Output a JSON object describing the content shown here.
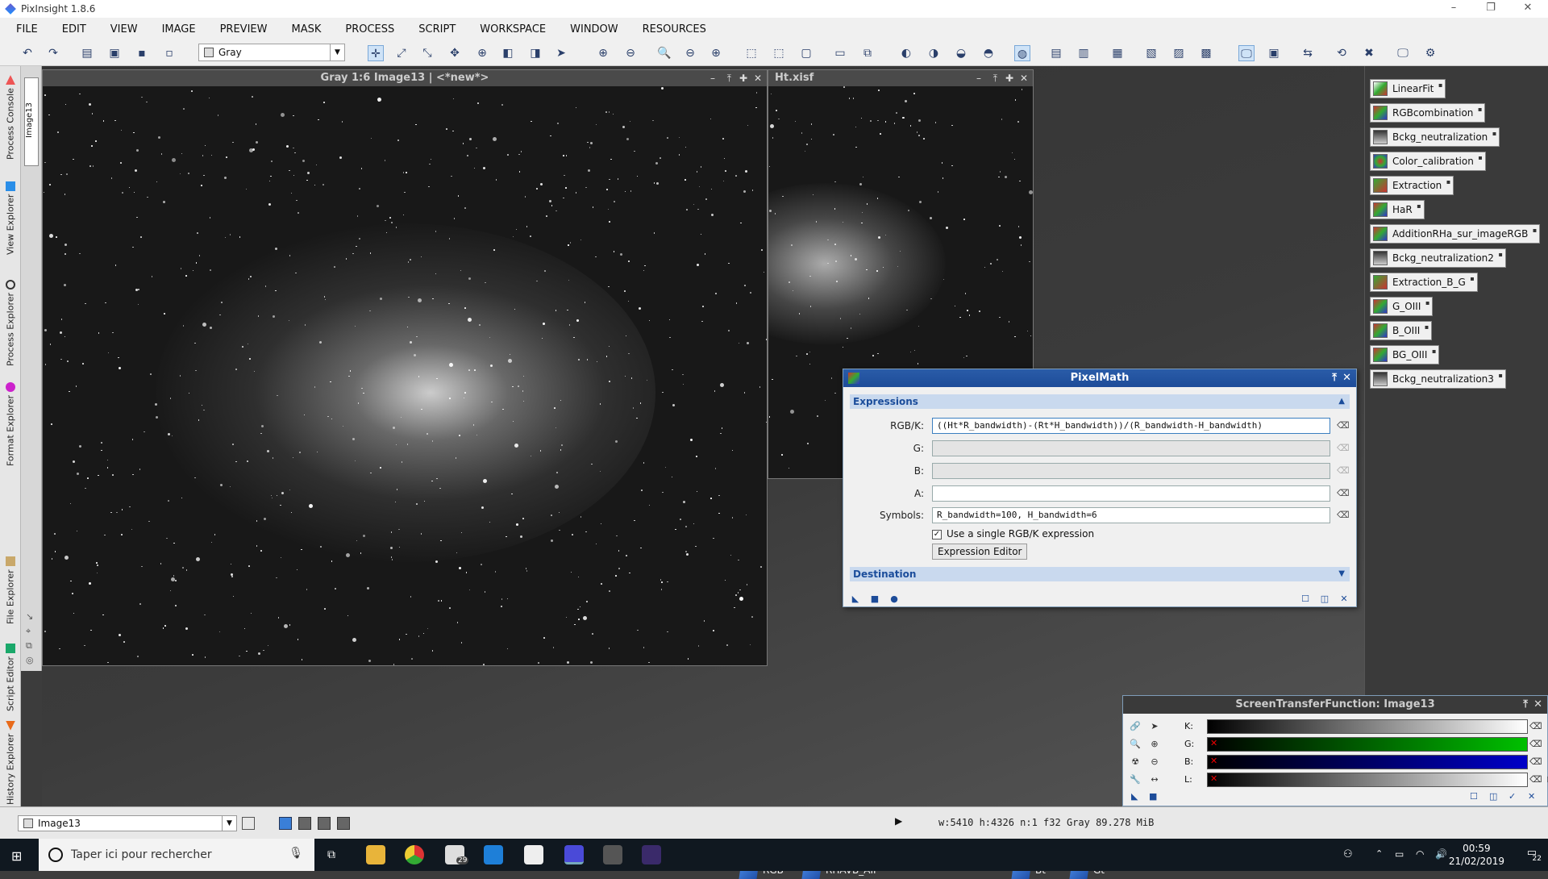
{
  "app": {
    "title": "PixInsight 1.8.6"
  },
  "window_controls": {
    "minimize": "–",
    "restore": "❐",
    "close": "✕"
  },
  "menu": [
    "FILE",
    "EDIT",
    "VIEW",
    "IMAGE",
    "PREVIEW",
    "MASK",
    "PROCESS",
    "SCRIPT",
    "WORKSPACE",
    "WINDOW",
    "RESOURCES"
  ],
  "toolbar": {
    "view_selector": "Gray"
  },
  "left_tabs": [
    "Process Console",
    "View Explorer",
    "Process Explorer",
    "Format Explorer",
    "File Explorer",
    "Script Editor",
    "History Explorer"
  ],
  "icon_tab": "Image13",
  "image_windows": [
    {
      "title": "Gray 1:6 Image13 | <*new*>"
    },
    {
      "title": "Ht.xisf"
    }
  ],
  "pixelmath": {
    "title": "PixelMath",
    "section_expressions": "Expressions",
    "labels": {
      "rgbk": "RGB/K:",
      "g": "G:",
      "b": "B:",
      "a": "A:",
      "symbols": "Symbols:"
    },
    "rgbk_expr": "((Ht*R_bandwidth)-(Rt*H_bandwidth))/(R_bandwidth-H_bandwidth)",
    "g_expr": "",
    "b_expr": "",
    "a_expr": "",
    "symbols": "R_bandwidth=100, H_bandwidth=6",
    "use_single_label": "Use a single RGB/K expression",
    "use_single": true,
    "expression_editor": "Expression Editor",
    "section_destination": "Destination"
  },
  "process_icons": [
    "LinearFit",
    "RGBcombination",
    "Bckg_neutralization",
    "Color_calibration",
    "Extraction",
    "HaR",
    "AdditionRHa_sur_imageRGB",
    "Bckg_neutralization2",
    "Extraction_B_G",
    "G_OIII",
    "B_OIII",
    "BG_OIII",
    "Bckg_neutralization3"
  ],
  "stf": {
    "title": "ScreenTransferFunction: Image13",
    "channels": [
      "K:",
      "G:",
      "B:",
      "L:"
    ]
  },
  "iconized_images": [
    "RGB",
    "RHAVB_AIP",
    "Bt",
    "Gt"
  ],
  "statusbar": {
    "current_view": "Image13",
    "info": "w:5410   h:4326   n:1   f32   Gray   89.278 MiB"
  },
  "taskbar": {
    "search_placeholder": "Taper ici pour rechercher",
    "mail_badge": "29",
    "time": "00:59",
    "date": "21/02/2019",
    "notif_count": "22"
  },
  "colors": {
    "accent": "#1d4c99",
    "section_bg": "#c9d9ee",
    "green": "#00c000",
    "blue": "#0000c8"
  }
}
